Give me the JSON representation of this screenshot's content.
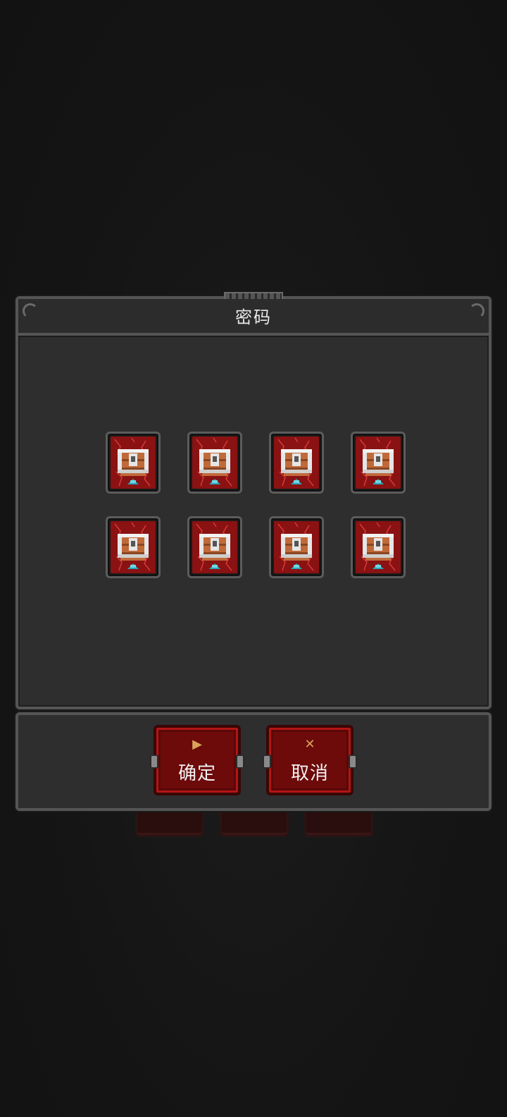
{
  "dialog": {
    "title": "密码"
  },
  "chests": [
    {
      "icon": "locked-chest-icon"
    },
    {
      "icon": "locked-chest-icon"
    },
    {
      "icon": "locked-chest-icon"
    },
    {
      "icon": "locked-chest-icon"
    },
    {
      "icon": "locked-chest-icon"
    },
    {
      "icon": "locked-chest-icon"
    },
    {
      "icon": "locked-chest-icon"
    },
    {
      "icon": "locked-chest-icon"
    }
  ],
  "buttons": {
    "confirm": {
      "label": "确定",
      "icon": "play-triangle-icon"
    },
    "cancel": {
      "label": "取消",
      "icon": "x-cross-icon"
    }
  },
  "colors": {
    "panel_bg": "#2e2e2e",
    "panel_border": "#555555",
    "button_red": "#6d0a0a",
    "chest_red": "#8a1212",
    "accent_gold": "#d9a35a"
  }
}
